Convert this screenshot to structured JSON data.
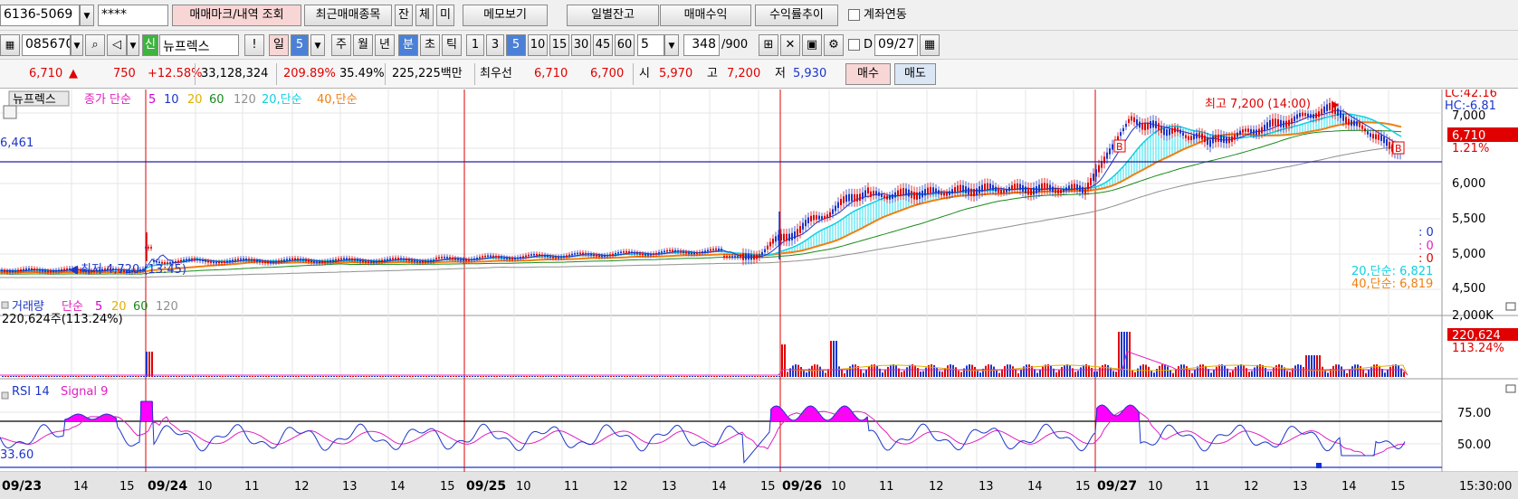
{
  "toolbar1": {
    "account": "6136-5069",
    "password": "****",
    "btn_trade_mark": "매매마크/내역 조회",
    "btn_recent": "최근매매종목",
    "btn_jan": "잔",
    "btn_che": "체",
    "btn_mi": "미",
    "btn_memo": "메모보기",
    "btn_daily_balance": "일별잔고",
    "btn_trade_profit": "매매수익",
    "btn_return_trend": "수익률추이",
    "account_link_label": "계좌연동"
  },
  "toolbar2": {
    "code": "085670",
    "sin": "신",
    "stock_name": "뉴프렉스",
    "excl": "!",
    "period_day": "일",
    "period_value": "5",
    "week": "주",
    "month": "월",
    "year": "년",
    "minute": "분",
    "second": "초",
    "tick": "틱",
    "intervals": [
      "1",
      "3",
      "5",
      "10",
      "15",
      "30",
      "45",
      "60"
    ],
    "interval_selected": "5",
    "count_value": "5",
    "bars_value": "348",
    "bars_total": "/900",
    "d_label": "D",
    "date_value": "09/27"
  },
  "quote": {
    "price": "6,710",
    "up_mark": "▲",
    "change": "750",
    "change_pct": "+12.58%",
    "volume": "33,128,324",
    "vol_ratio": "209.89%",
    "turnover": "35.49%",
    "amount": "225,225백만",
    "best_label": "최우선",
    "ask": "6,710",
    "bid": "6,700",
    "open_label": "시",
    "open": "5,970",
    "high_label": "고",
    "high": "7,200",
    "low_label": "저",
    "low": "5,930",
    "buy_btn": "매수",
    "sell_btn": "매도"
  },
  "price_panel": {
    "stock_tag": "뉴프렉스",
    "legend_close": "종가 단순",
    "ma5": "5",
    "ma10": "10",
    "ma20": "20",
    "ma60": "60",
    "ma120": "120",
    "ma20w": "20,단순",
    "ma40w": "40,단순",
    "high_note": "최고 7,200 (14:00)",
    "low_note": "최저 4,720 (13:45)",
    "hline_value": "6,461",
    "lc": "LC:42.16",
    "hc": "HC:-6.81",
    "price_tag": "6,710",
    "pct_tag": "1.21%",
    "zero1": ": 0",
    "zero2": ": 0",
    "zero3": ": 0",
    "ma20_value": "20,단순: 6,821",
    "ma40_value": "40,단순: 6,819",
    "mark_b": "B",
    "y_ticks": [
      "7,000",
      "6,500",
      "6,000",
      "5,500",
      "5,000",
      "4,500"
    ]
  },
  "volume_panel": {
    "title": "거래량",
    "simple": "단순",
    "ma5": "5",
    "ma20": "20",
    "ma60": "60",
    "ma120": "120",
    "current": "220,624주(113.24%)",
    "y_tick": "2,000K",
    "value_tag": "220,624",
    "pct_tag": "113.24%"
  },
  "rsi_panel": {
    "title": "RSI 14",
    "signal": "Signal 9",
    "left_value": "33.60",
    "y_ticks": [
      "75.00",
      "50.00"
    ]
  },
  "x_axis": {
    "labels": [
      "09/23",
      "14",
      "15",
      "09/24",
      "10",
      "11",
      "12",
      "13",
      "14",
      "15",
      "09/25",
      "10",
      "11",
      "12",
      "13",
      "14",
      "15",
      "09/26",
      "10",
      "11",
      "12",
      "13",
      "14",
      "15",
      "09/27",
      "10",
      "11",
      "12",
      "13",
      "14",
      "15"
    ],
    "clock": "15:30:00"
  },
  "colors": {
    "up": "#e00000",
    "down": "#1c36c8",
    "ma20_fill": "#29e0f0",
    "ma40": "#f07f10",
    "rsi_fill": "#ff00ff"
  }
}
